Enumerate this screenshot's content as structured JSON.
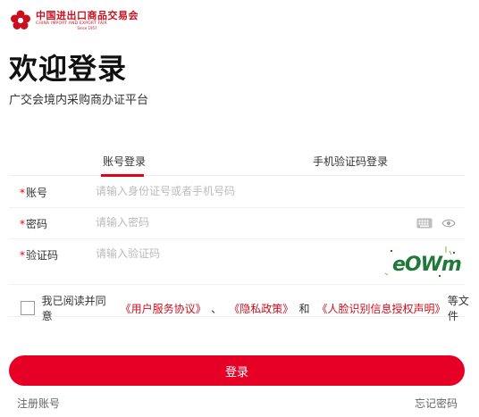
{
  "brand": {
    "name_cn": "中国进出口商品交易会",
    "name_en": "CHINA IMPORT AND EXPORT FAIR",
    "since": "Since 1957",
    "color": "#c8101e"
  },
  "page": {
    "title": "欢迎登录",
    "subtitle": "广交会境内采购商办证平台"
  },
  "tabs": [
    {
      "label": "账号登录",
      "active": true
    },
    {
      "label": "手机验证码登录",
      "active": false
    }
  ],
  "form": {
    "account": {
      "star": "*",
      "label": "账号",
      "placeholder": "请输入身份证号或者手机号码",
      "value": ""
    },
    "password": {
      "star": "*",
      "label": "密码",
      "placeholder": "请输入密码",
      "value": ""
    },
    "captcha": {
      "star": "*",
      "label": "验证码",
      "placeholder": "请输入验证码",
      "value": "",
      "image_text": "eOWm"
    }
  },
  "agreement": {
    "prefix": "我已阅读并同意",
    "link1": "《用户服务协议》",
    "sep": "、",
    "link2": "《隐私政策》",
    "and": "和",
    "link3": "《人脸识别信息授权声明》",
    "suffix": "等文件",
    "checked": false
  },
  "actions": {
    "login": "登录",
    "register": "注册账号",
    "forgot": "忘记密码"
  },
  "colors": {
    "accent": "#e60026",
    "link": "#c8101e",
    "placeholder": "#bbbbbb"
  }
}
